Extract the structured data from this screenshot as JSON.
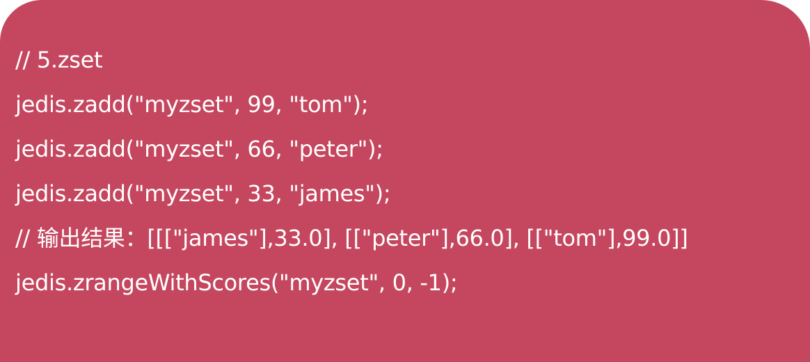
{
  "slide": {
    "background_color": "#c5475f",
    "text_color": "#ffffff",
    "lines": [
      "// 5.zset",
      "jedis.zadd(\"myzset\", 99, \"tom\");",
      "jedis.zadd(\"myzset\", 66, \"peter\");",
      "jedis.zadd(\"myzset\", 33, \"james\");",
      "// 输出结果：[[[\"james\"],33.0], [[\"peter\"],66.0], [[\"tom\"],99.0]]",
      "jedis.zrangeWithScores(\"myzset\", 0, -1);"
    ]
  }
}
